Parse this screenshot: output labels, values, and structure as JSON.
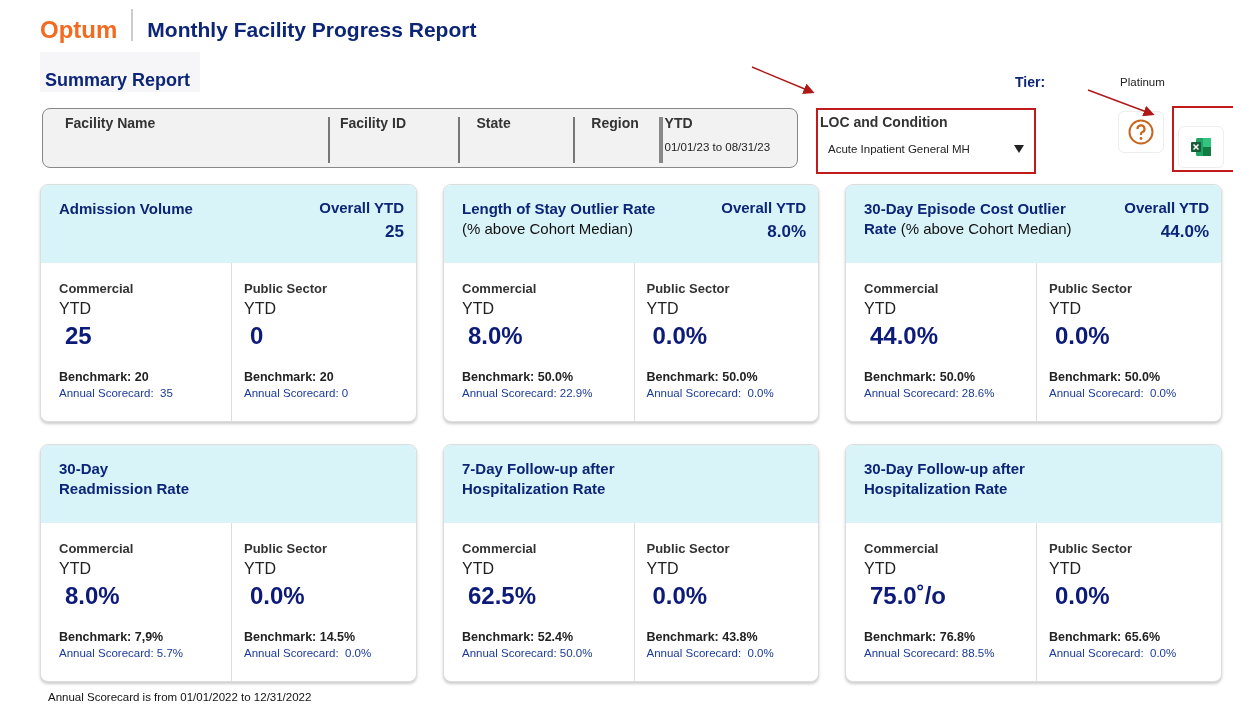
{
  "header": {
    "logo": "Optum",
    "title": "Monthly Facility Progress Report"
  },
  "summary_title": "Summary Report",
  "filters": {
    "columns": [
      {
        "label": "Facility Name"
      },
      {
        "label": "Facility ID"
      },
      {
        "label": "State"
      },
      {
        "label": "Region"
      },
      {
        "label": "YTD",
        "value": "01/01/23 to 08/31/23"
      }
    ]
  },
  "loc": {
    "label": "LOC and Condition",
    "value": "Acute Inpatient General MH"
  },
  "tier": {
    "label": "Tier:",
    "value": "Platinum"
  },
  "cards": [
    {
      "title": [
        "Admission Volume"
      ],
      "overall_label": "Overall YTD",
      "overall_value": "25",
      "sections": [
        {
          "segment": "Commercial",
          "period": "YTD",
          "value": "25",
          "benchmark": "Benchmark: 20",
          "scorecard": "Annual Scorecard:  35"
        },
        {
          "segment": "Public Sector",
          "period": "YTD",
          "value": "0",
          "benchmark": "Benchmark: 20",
          "scorecard": "Annual Scorecard: 0"
        }
      ]
    },
    {
      "title": [
        "Length of Stay Outlier Rate"
      ],
      "note": "(% above Cohort Median)",
      "overall_label": "Overall YTD",
      "overall_value": "8.0%",
      "sections": [
        {
          "segment": "Commercial",
          "period": "YTD",
          "value": "8.0%",
          "benchmark": "Benchmark: 50.0%",
          "scorecard": "Annual Scorecard: 22.9%"
        },
        {
          "segment": "Public Sector",
          "period": "YTD",
          "value": "0.0%",
          "benchmark": "Benchmark: 50.0%",
          "scorecard": "Annual Scorecard:  0.0%"
        }
      ]
    },
    {
      "title": [
        "30-Day Episode Cost Outlier",
        "Rate"
      ],
      "note": "(% above Cohort Median)",
      "overall_label": "Overall YTD",
      "overall_value": "44.0%",
      "sections": [
        {
          "segment": "Commercial",
          "period": "YTD",
          "value": "44.0%",
          "benchmark": "Benchmark: 50.0%",
          "scorecard": "Annual Scorecard: 28.6%"
        },
        {
          "segment": "Public Sector",
          "period": "YTD",
          "value": "0.0%",
          "benchmark": "Benchmark: 50.0%",
          "scorecard": "Annual Scorecard:  0.0%"
        }
      ]
    },
    {
      "title": [
        "30-Day",
        "Readmission Rate"
      ],
      "sections": [
        {
          "segment": "Commercial",
          "period": "YTD",
          "value": "8.0%",
          "benchmark": "Benchmark: 7,9%",
          "scorecard": "Annual Scorecard: 5.7%"
        },
        {
          "segment": "Public Sector",
          "period": "YTD",
          "value": "0.0%",
          "benchmark": "Benchmark: 14.5%",
          "scorecard": "Annual Scorecard:  0.0%"
        }
      ]
    },
    {
      "title": [
        "7-Day Follow-up after",
        "Hospitalization Rate"
      ],
      "sections": [
        {
          "segment": "Commercial",
          "period": "YTD",
          "value": "62.5%",
          "benchmark": "Benchmark: 52.4%",
          "scorecard": "Annual Scorecard: 50.0%"
        },
        {
          "segment": "Public Sector",
          "period": "YTD",
          "value": "0.0%",
          "benchmark": "Benchmark: 43.8%",
          "scorecard": "Annual Scorecard:  0.0%"
        }
      ]
    },
    {
      "title": [
        "30-Day Follow-up after",
        "Hospitalization Rate"
      ],
      "sections": [
        {
          "segment": "Commercial",
          "period": "YTD",
          "value": "75.0˚/o",
          "benchmark": "Benchmark: 76.8%",
          "scorecard": "Annual Scorecard: 88.5%"
        },
        {
          "segment": "Public Sector",
          "period": "YTD",
          "value": "0.0%",
          "benchmark": "Benchmark: 65.6%",
          "scorecard": "Annual Scorecard:  0.0%"
        }
      ]
    }
  ],
  "footnote": "Annual Scorecard is from 01/01/2022 to 12/31/2022"
}
